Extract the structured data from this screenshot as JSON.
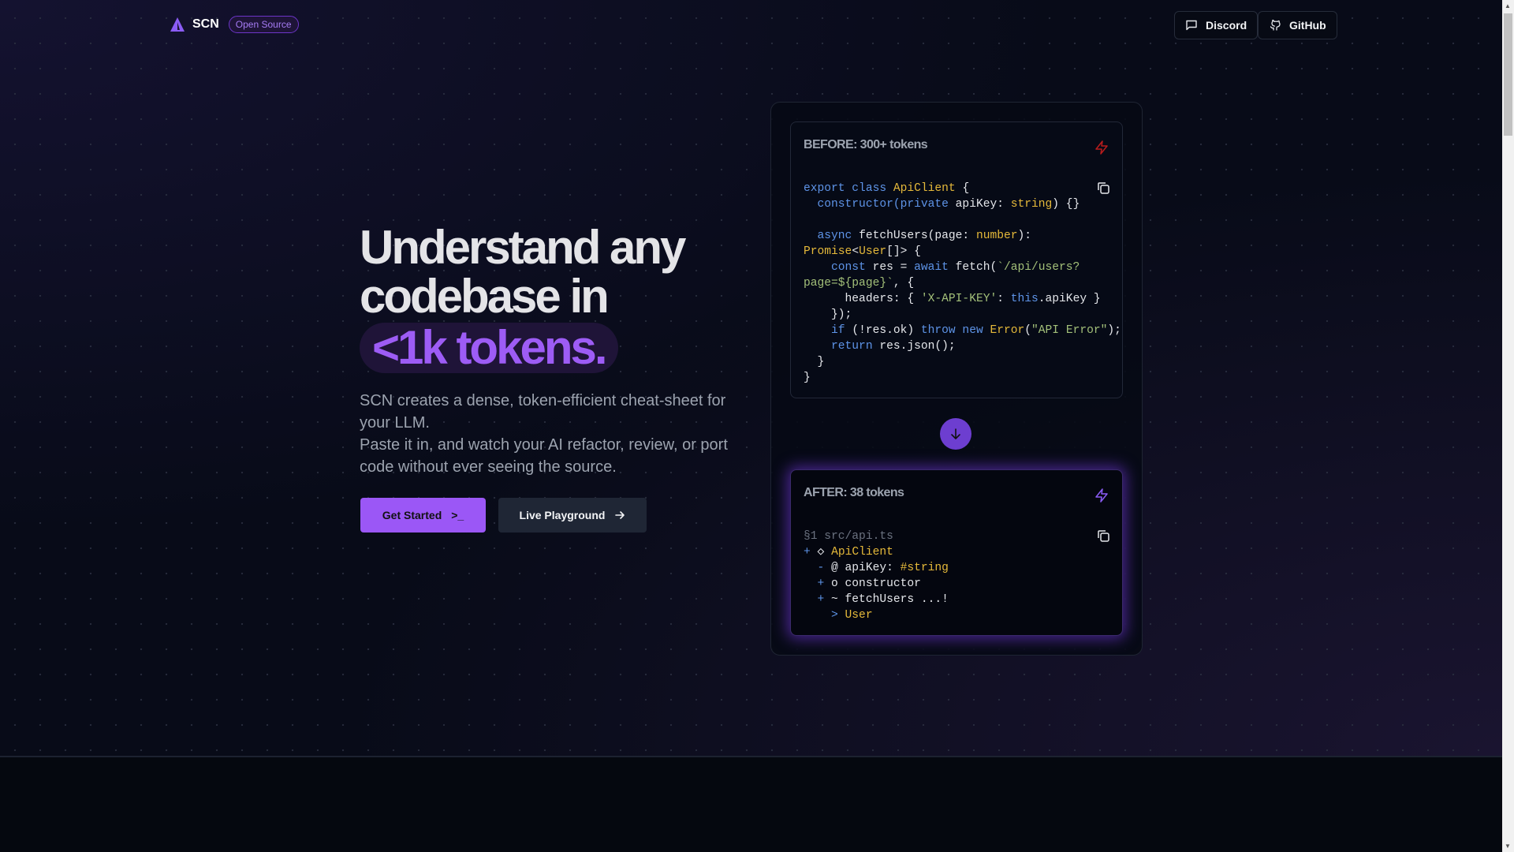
{
  "nav": {
    "brand": "SCN",
    "badge": "Open Source",
    "discord": "Discord",
    "github": "GitHub"
  },
  "hero": {
    "line1": "Understand any",
    "line2": "codebase in",
    "highlight": "<1k tokens.",
    "para1": "SCN creates a dense, token-efficient cheat-sheet for your LLM.",
    "para2": "Paste it in, and watch your AI refactor, review, or port code without ever seeing the source.",
    "get_started": "Get Started",
    "get_started_icon": ">_",
    "playground": "Live Playground"
  },
  "colors": {
    "accent": "#9b57f6",
    "bolt_before": "#b91c1c",
    "bolt_after": "#8b5cf6"
  },
  "before": {
    "title": "BEFORE: 300+ tokens",
    "lines": [
      [
        [
          "export class ",
          "kw"
        ],
        [
          "ApiClient",
          "ty"
        ],
        [
          " {",
          "pl"
        ]
      ],
      [
        [
          "  constructor(",
          "kw"
        ],
        [
          "private",
          "kw"
        ],
        [
          " apiKey: ",
          "pl"
        ],
        [
          "string",
          "ty"
        ],
        [
          ") {}",
          "pl"
        ]
      ],
      [
        [
          "",
          "pl"
        ]
      ],
      [
        [
          "  async ",
          "kw"
        ],
        [
          "fetchUsers(page: ",
          "pl"
        ],
        [
          "number",
          "ty"
        ],
        [
          "):",
          "pl"
        ]
      ],
      [
        [
          "Promise",
          "ty"
        ],
        [
          "<",
          "pl"
        ],
        [
          "User",
          "ty"
        ],
        [
          "[]> {",
          "pl"
        ]
      ],
      [
        [
          "    const ",
          "kw"
        ],
        [
          "res = ",
          "pl"
        ],
        [
          "await ",
          "kw"
        ],
        [
          "fetch(",
          "pl"
        ],
        [
          "`/api/users?",
          "st"
        ]
      ],
      [
        [
          "page=${page}`",
          "st"
        ],
        [
          ", {",
          "pl"
        ]
      ],
      [
        [
          "      headers: { ",
          "pl"
        ],
        [
          "'X-API-KEY'",
          "st"
        ],
        [
          ": ",
          "pl"
        ],
        [
          "this",
          "kw"
        ],
        [
          ".apiKey }",
          "pl"
        ]
      ],
      [
        [
          "    });",
          "pl"
        ]
      ],
      [
        [
          "    if ",
          "kw"
        ],
        [
          "(!res.ok) ",
          "pl"
        ],
        [
          "throw new ",
          "kw"
        ],
        [
          "Error",
          "ty"
        ],
        [
          "(",
          "pl"
        ],
        [
          "\"API Error\"",
          "st"
        ],
        [
          ");",
          "pl"
        ]
      ],
      [
        [
          "    return ",
          "kw"
        ],
        [
          "res.json();",
          "pl"
        ]
      ],
      [
        [
          "  }",
          "pl"
        ]
      ],
      [
        [
          "}",
          "pl"
        ]
      ]
    ]
  },
  "after": {
    "title": "AFTER: 38 tokens",
    "lines": [
      [
        [
          "§1 src/api.ts",
          "cm"
        ]
      ],
      [
        [
          "+ ",
          "kw"
        ],
        [
          "◇ ",
          "pl"
        ],
        [
          "ApiClient",
          "ty"
        ]
      ],
      [
        [
          "  - ",
          "kw"
        ],
        [
          "@ apiKey: ",
          "pl"
        ],
        [
          "#string",
          "ty"
        ]
      ],
      [
        [
          "  + ",
          "kw"
        ],
        [
          "o constructor",
          "pl"
        ]
      ],
      [
        [
          "  + ",
          "kw"
        ],
        [
          "~ fetchUsers ...!",
          "pl"
        ]
      ],
      [
        [
          "    > ",
          "kw"
        ],
        [
          "User",
          "ty"
        ]
      ]
    ]
  }
}
